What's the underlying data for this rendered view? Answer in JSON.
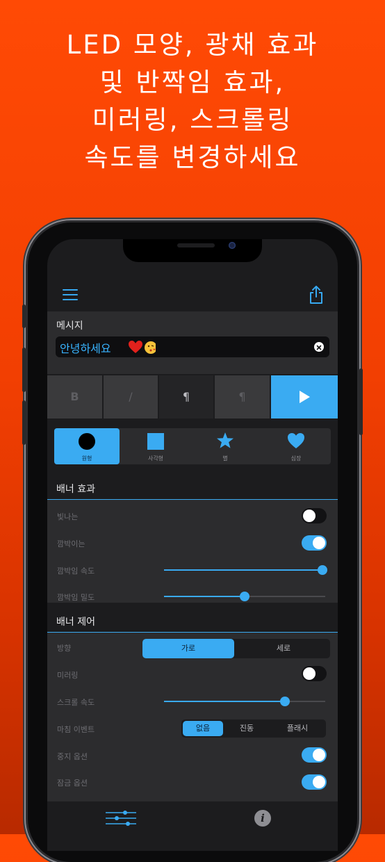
{
  "headline": {
    "lines": [
      "LED 모양, 광채 효과",
      "및 반짝임 효과,",
      "미러링, 스크롤링",
      "속도를 변경하세요"
    ]
  },
  "message": {
    "label": "메시지",
    "value": "안녕하세요",
    "emoji": "heart and kiss emoji"
  },
  "format_buttons": [
    "B",
    "/",
    "¶",
    "¶"
  ],
  "shapes": [
    {
      "label": "원형",
      "icon": "circle-icon",
      "selected": true
    },
    {
      "label": "사각형",
      "icon": "square-icon",
      "selected": false
    },
    {
      "label": "별",
      "icon": "star-icon",
      "selected": false
    },
    {
      "label": "심장",
      "icon": "heart-icon",
      "selected": false
    }
  ],
  "banner_effects": {
    "title": "배너 효과",
    "glow_label": "빛나는",
    "glow_on": false,
    "blink_label": "깜박이는",
    "blink_on": true,
    "blink_speed_label": "깜박임 속도",
    "blink_speed": 1.0,
    "blink_density_label": "깜박임 밀도",
    "blink_density": 0.5
  },
  "banner_control": {
    "title": "배너 제어",
    "direction_label": "방향",
    "direction_options": [
      "가로",
      "세로"
    ],
    "direction_selected": "가로",
    "mirror_label": "미러링",
    "mirror_on": false,
    "scroll_speed_label": "스크롤 속도",
    "scroll_speed": 0.75,
    "finish_event_label": "마침 이벤트",
    "finish_options": [
      "없음",
      "진동",
      "플래시"
    ],
    "finish_selected": "없음",
    "stop_option_label": "중지 옵션",
    "stop_option_on": true,
    "lock_option_label": "잠금 옵션",
    "lock_option_on": true
  },
  "colors": {
    "accent": "#3aabf2",
    "background_orange": "#f23f02"
  }
}
